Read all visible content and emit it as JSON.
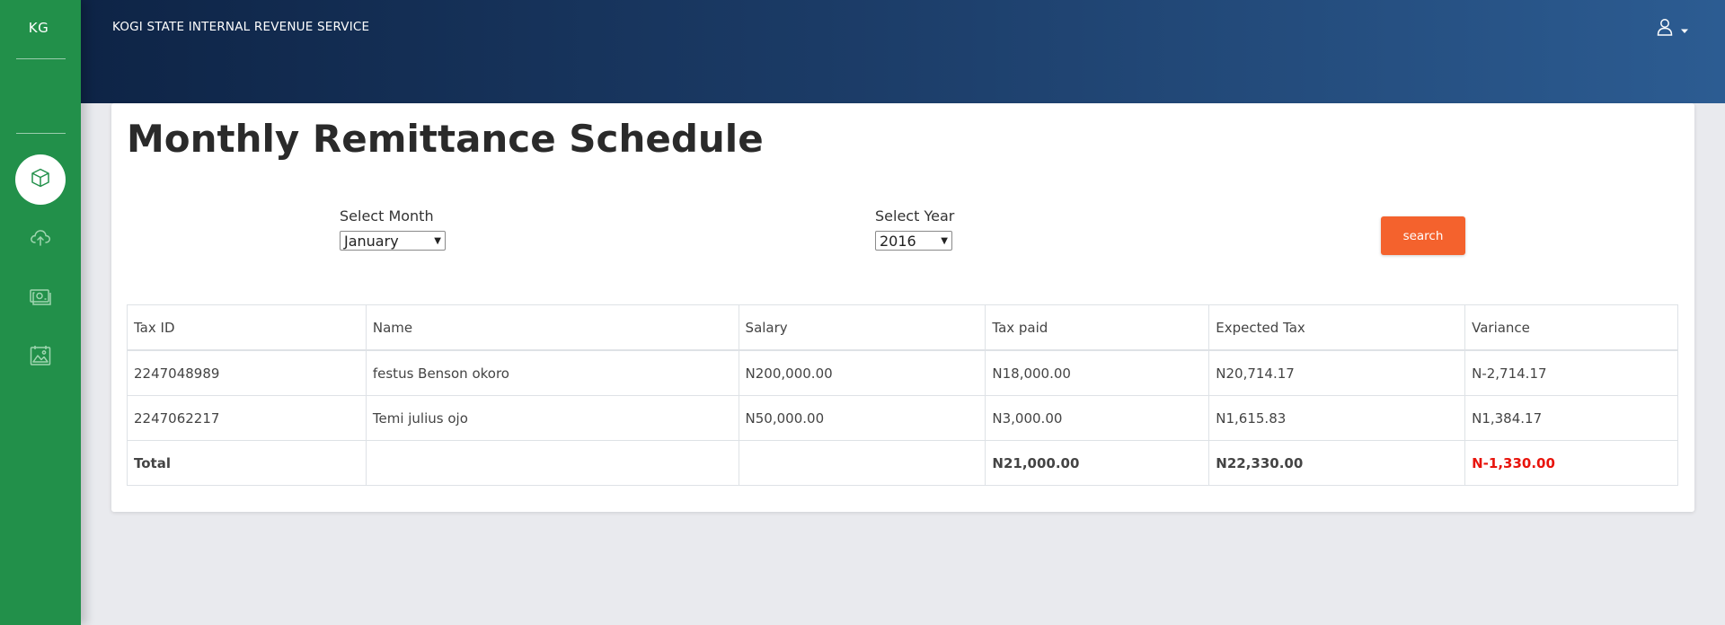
{
  "sidebar": {
    "brand": "KG",
    "items": [
      {
        "icon": "box-icon",
        "active": true
      },
      {
        "icon": "cloud-upload-icon",
        "active": false
      },
      {
        "icon": "money-icon",
        "active": false
      },
      {
        "icon": "image-icon",
        "active": false
      }
    ]
  },
  "header": {
    "org_name": "KOGI STATE INTERNAL REVENUE SERVICE",
    "user_icon": "user-icon",
    "caret_icon": "caret-down-icon"
  },
  "page": {
    "title": "Monthly Remittance Schedule",
    "month_label": "Select Month",
    "month_value": "January",
    "year_label": "Select Year",
    "year_value": "2016",
    "search_label": "search"
  },
  "table": {
    "headers": [
      "Tax ID",
      "Name",
      "Salary",
      "Tax paid",
      "Expected Tax",
      "Variance"
    ],
    "rows": [
      {
        "tax_id": "2247048989",
        "name": "festus Benson okoro",
        "salary": "N200,000.00",
        "tax_paid": "N18,000.00",
        "expected": "N20,714.17",
        "variance": "N-2,714.17"
      },
      {
        "tax_id": "2247062217",
        "name": "Temi julius ojo",
        "salary": "N50,000.00",
        "tax_paid": "N3,000.00",
        "expected": "N1,615.83",
        "variance": "N1,384.17"
      }
    ],
    "total": {
      "label": "Total",
      "tax_paid": "N21,000.00",
      "expected": "N22,330.00",
      "variance": "N-1,330.00"
    }
  },
  "colors": {
    "sidebar": "#22904a",
    "header_start": "#0e2446",
    "header_end": "#2c5c92",
    "search_button": "#f4622d",
    "variance_negative": "#e82525",
    "variance_positive": "#2d3fd6"
  }
}
